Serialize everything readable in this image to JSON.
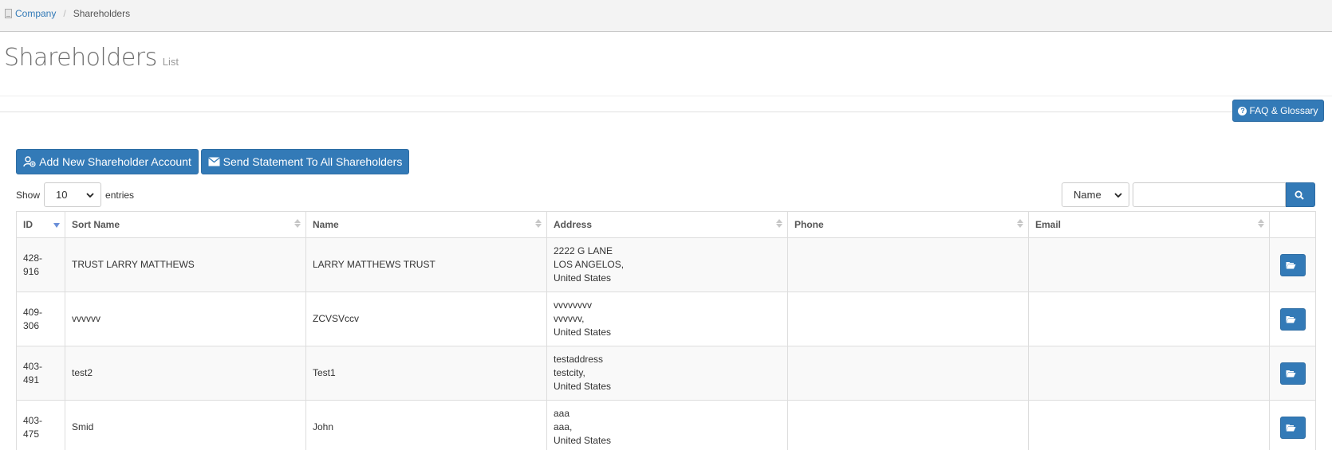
{
  "breadcrumb": {
    "company": "Company",
    "separator": "/",
    "current": "Shareholders"
  },
  "page": {
    "title": "Shareholders",
    "subtitle": "List"
  },
  "buttons": {
    "faq": "FAQ & Glossary",
    "add_shareholder": "Add New Shareholder Account",
    "send_statement": "Send Statement To All Shareholders"
  },
  "length_menu": {
    "prefix": "Show",
    "value": "10",
    "suffix": "entries"
  },
  "search": {
    "field_value": "Name",
    "query": ""
  },
  "table": {
    "columns": [
      "ID",
      "Sort Name",
      "Name",
      "Address",
      "Phone",
      "Email"
    ],
    "sorted_column": "ID",
    "rows": [
      {
        "id": "428-916",
        "sort_name": "TRUST LARRY MATTHEWS",
        "name": "LARRY MATTHEWS TRUST",
        "address": [
          "2222 G LANE",
          "LOS ANGELOS,",
          "United States"
        ],
        "phone": "",
        "email": ""
      },
      {
        "id": "409-306",
        "sort_name": "vvvvvv",
        "name": "ZCVSVccv",
        "address": [
          "vvvvvvvv",
          "vvvvvv,",
          "United States"
        ],
        "phone": "",
        "email": ""
      },
      {
        "id": "403-491",
        "sort_name": "test2",
        "name": "Test1",
        "address": [
          "testaddress",
          "testcity,",
          "United States"
        ],
        "phone": "",
        "email": ""
      },
      {
        "id": "403-475",
        "sort_name": "Smid",
        "name": "John",
        "address": [
          "aaa",
          "aaa,",
          "United States"
        ],
        "phone": "",
        "email": ""
      }
    ]
  },
  "colors": {
    "primary": "#337ab7",
    "link": "#337ab7",
    "topbar": "#f3f3f3"
  },
  "icons": {
    "breadcrumb": "building-icon",
    "faq": "question-circle-icon",
    "add": "user-add-icon",
    "send": "envelope-icon",
    "search": "search-icon",
    "open": "folder-open-icon"
  }
}
